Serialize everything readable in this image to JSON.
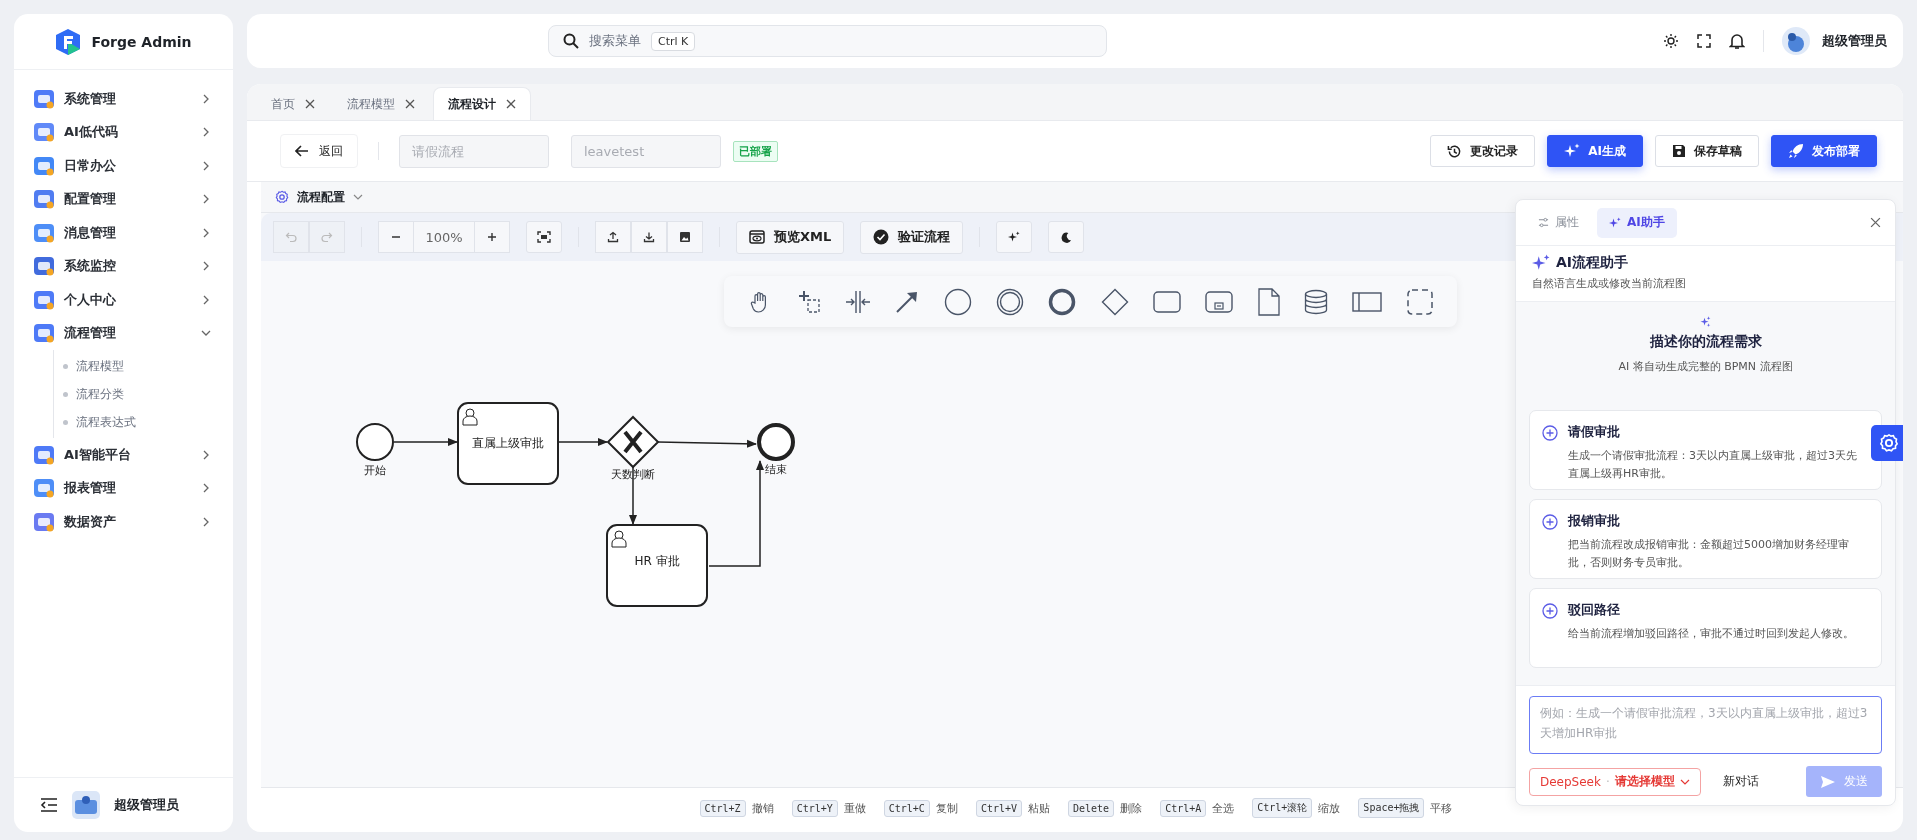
{
  "sidebar": {
    "brand": "Forge Admin",
    "items": [
      {
        "label": "系统管理",
        "expanded": false
      },
      {
        "label": "AI低代码",
        "expanded": false
      },
      {
        "label": "日常办公",
        "expanded": false
      },
      {
        "label": "配置管理",
        "expanded": false
      },
      {
        "label": "消息管理",
        "expanded": false
      },
      {
        "label": "系统监控",
        "expanded": false
      },
      {
        "label": "个人中心",
        "expanded": false
      },
      {
        "label": "流程管理",
        "expanded": true,
        "children": [
          {
            "label": "流程模型"
          },
          {
            "label": "流程分类"
          },
          {
            "label": "流程表达式"
          }
        ]
      },
      {
        "label": "AI智能平台",
        "expanded": false
      },
      {
        "label": "报表管理",
        "expanded": false
      },
      {
        "label": "数据资产",
        "expanded": false
      }
    ],
    "footer": {
      "user": "超级管理员"
    }
  },
  "header": {
    "search": {
      "placeholder": "搜索菜单",
      "shortcut": "Ctrl K"
    },
    "user": "超级管理员"
  },
  "tabs": [
    {
      "label": "首页",
      "selected": false
    },
    {
      "label": "流程模型",
      "selected": false
    },
    {
      "label": "流程设计",
      "selected": true
    }
  ],
  "toolbar": {
    "back": "返回",
    "name_field": {
      "placeholder": "请假流程"
    },
    "key_field": {
      "placeholder": "leavetest"
    },
    "status": "已部署",
    "buttons": [
      {
        "label": "更改记录",
        "kind": "history",
        "primary": false
      },
      {
        "label": "AI生成",
        "kind": "ai",
        "primary": true
      },
      {
        "label": "保存草稿",
        "kind": "save",
        "primary": false
      },
      {
        "label": "发布部署",
        "kind": "publish",
        "primary": true
      }
    ]
  },
  "config": {
    "label": "流程配置"
  },
  "canvas_toolbar": {
    "zoom": "100%",
    "buttons": [
      {
        "label": "预览XML",
        "kind": "xml"
      },
      {
        "label": "验证流程",
        "kind": "validate"
      }
    ]
  },
  "diagram": {
    "nodes": [
      {
        "kind": "start",
        "label": "开始"
      },
      {
        "kind": "user_task",
        "label": "直属上级审批"
      },
      {
        "kind": "gateway",
        "label": "天数判断"
      },
      {
        "kind": "end",
        "label": "结束"
      },
      {
        "kind": "user_task",
        "label": "HR 审批"
      }
    ]
  },
  "panel": {
    "tabs": [
      {
        "label": "属性",
        "selected": false
      },
      {
        "label": "AI助手",
        "selected": true
      }
    ],
    "title": "AI流程助手",
    "subtitle": "自然语言生成或修改当前流程图",
    "empty_title": "描述你的流程需求",
    "empty_subtitle": "AI 将自动生成完整的 BPMN 流程图",
    "suggestions": [
      {
        "title": "请假审批",
        "text": "生成一个请假审批流程：3天以内直属上级审批，超过3天先直属上级再HR审批。"
      },
      {
        "title": "报销审批",
        "text": "把当前流程改成报销审批：金额超过5000增加财务经理审批，否则财务专员审批。"
      },
      {
        "title": "驳回路径",
        "text": "给当前流程增加驳回路径，审批不通过时回到发起人修改。"
      }
    ],
    "input": {
      "placeholder": "例如：生成一个请假审批流程，3天以内直属上级审批，超过3天增加HR审批"
    },
    "model": {
      "provider": "DeepSeek",
      "separator": "·",
      "label": "请选择模型"
    },
    "new_chat": "新对话",
    "send": {
      "label": "发送",
      "disabled": true
    }
  },
  "shortcuts": [
    {
      "key": "Ctrl+Z",
      "action": "撤销"
    },
    {
      "key": "Ctrl+Y",
      "action": "重做"
    },
    {
      "key": "Ctrl+C",
      "action": "复制"
    },
    {
      "key": "Ctrl+V",
      "action": "粘贴"
    },
    {
      "key": "Delete",
      "action": "删除"
    },
    {
      "key": "Ctrl+A",
      "action": "全选"
    },
    {
      "key": "Ctrl+滚轮",
      "action": "缩放"
    },
    {
      "key": "Space+拖拽",
      "action": "平移"
    }
  ]
}
